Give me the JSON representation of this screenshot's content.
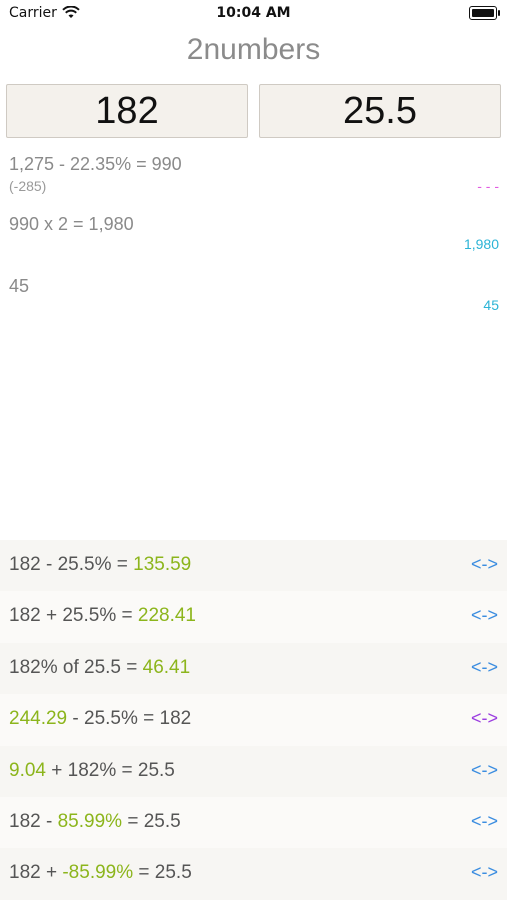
{
  "status": {
    "carrier": "Carrier",
    "time": "10:04 AM"
  },
  "title": "2numbers",
  "inputs": {
    "first": "182",
    "second": "25.5"
  },
  "calculations": [
    {
      "line": "1,275 - 22.35% = 990",
      "sub": "(-285)",
      "right": "- - -",
      "right_color": "#e25be2"
    },
    {
      "line": "990 x 2 = 1,980",
      "sub": "",
      "right": "1,980",
      "right_color": "#2bb4d6"
    },
    {
      "line": "45",
      "sub": "",
      "right": "45",
      "right_color": "#2bb4d6"
    }
  ],
  "rows": [
    {
      "parts": [
        {
          "t": "182 - 25.5% = ",
          "g": false
        },
        {
          "t": "135.59",
          "g": true
        }
      ],
      "swap": "<->",
      "swap_color": "#3b8de0"
    },
    {
      "parts": [
        {
          "t": "182 + 25.5% = ",
          "g": false
        },
        {
          "t": "228.41",
          "g": true
        }
      ],
      "swap": "<->",
      "swap_color": "#3b8de0"
    },
    {
      "parts": [
        {
          "t": "182% of 25.5 = ",
          "g": false
        },
        {
          "t": "46.41",
          "g": true
        }
      ],
      "swap": "<->",
      "swap_color": "#3b8de0"
    },
    {
      "parts": [
        {
          "t": "244.29",
          "g": true
        },
        {
          "t": " - 25.5% = 182",
          "g": false
        }
      ],
      "swap": "<->",
      "swap_color": "#9b3de0"
    },
    {
      "parts": [
        {
          "t": "9.04",
          "g": true
        },
        {
          "t": " + 182% = 25.5",
          "g": false
        }
      ],
      "swap": "<->",
      "swap_color": "#3b8de0"
    },
    {
      "parts": [
        {
          "t": "182 - ",
          "g": false
        },
        {
          "t": "85.99%",
          "g": true
        },
        {
          "t": " = 25.5",
          "g": false
        }
      ],
      "swap": "<->",
      "swap_color": "#3b8de0"
    },
    {
      "parts": [
        {
          "t": "182 + ",
          "g": false
        },
        {
          "t": "-85.99%",
          "g": true
        },
        {
          "t": " = 25.5",
          "g": false
        }
      ],
      "swap": "<->",
      "swap_color": "#3b8de0"
    }
  ],
  "colors": {
    "accent_green": "#8cb51c",
    "swap_blue": "#3b8de0",
    "swap_purple": "#9b3de0",
    "cyan": "#2bb4d6",
    "magenta": "#e25be2"
  }
}
